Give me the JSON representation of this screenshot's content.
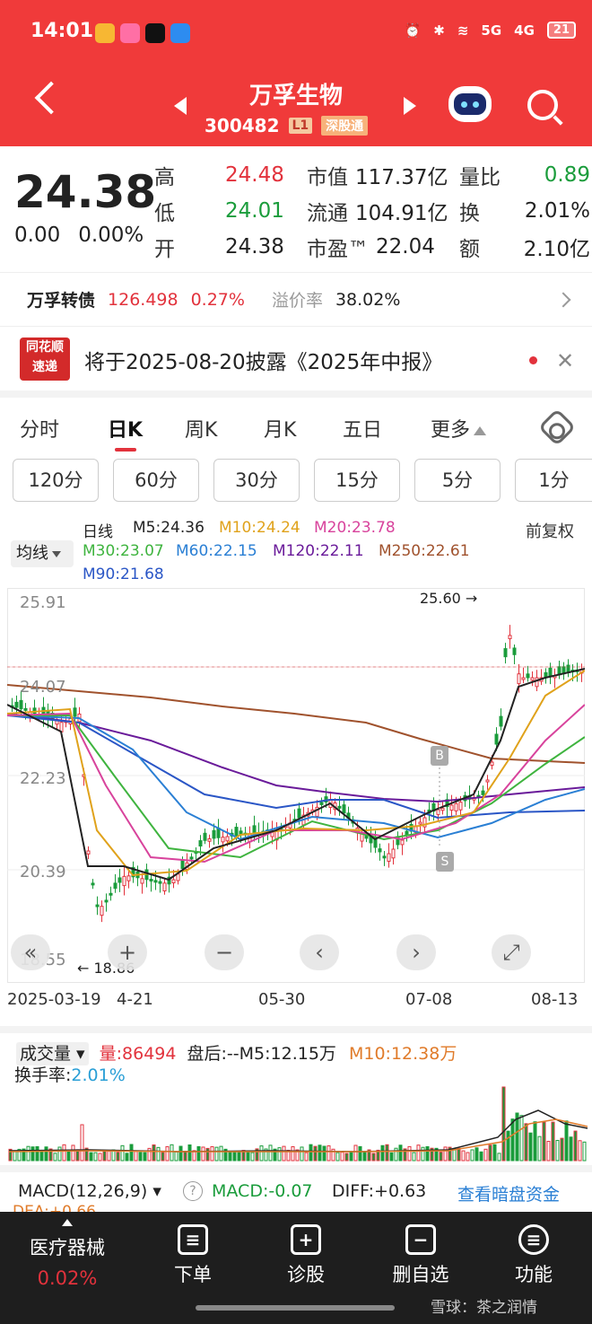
{
  "status_bar": {
    "time": "14:01",
    "net1": "5G",
    "net2": "4G",
    "battery": "21"
  },
  "header": {
    "name": "万孚生物",
    "code": "300482",
    "level_tag": "L1",
    "connect_tag": "深股通"
  },
  "quote": {
    "price": "24.38",
    "change": "0.00",
    "change_pct": "0.00%",
    "high_label": "高",
    "high": "24.48",
    "low_label": "低",
    "low": "24.01",
    "open_label": "开",
    "open": "24.38",
    "mktcap_label": "市值",
    "mktcap": "117.37亿",
    "float_label": "流通",
    "float": "104.91亿",
    "pe_label": "市盈™",
    "pe": "22.04",
    "volratio_label": "量比",
    "volratio": "0.89",
    "turnover_label": "换",
    "turnover": "2.01%",
    "amount_label": "额",
    "amount": "2.10亿"
  },
  "bond": {
    "name": "万孚转债",
    "price": "126.498",
    "pct": "0.27%",
    "premium_label": "溢价率",
    "premium": "38.02%"
  },
  "news": {
    "logo1": "同花顺",
    "logo2": "速递",
    "text": "将于2025-08-20披露《2025年中报》"
  },
  "tabs": [
    "分时",
    "日K",
    "周K",
    "月K",
    "五日",
    "更多"
  ],
  "periods": [
    "120分",
    "60分",
    "30分",
    "15分",
    "5分",
    "1分"
  ],
  "ma": {
    "selector": "均线",
    "line_type": "日线",
    "adjust": "前复权",
    "m5": "M5:24.36",
    "m10": "M10:24.24",
    "m20": "M20:23.78",
    "m30": "M30:23.07",
    "m60": "M60:22.15",
    "m120": "M120:22.11",
    "m250": "M250:22.61",
    "m90": "M90:21.68"
  },
  "chart": {
    "y_labels": [
      "25.91",
      "24.07",
      "22.23",
      "20.39",
      "18.55"
    ],
    "high_marker": "25.60",
    "low_marker": "18.86",
    "buy_tag": "B",
    "sell_tag": "S",
    "dates": [
      "2025-03-19",
      "4-21",
      "05-30",
      "07-08",
      "08-13"
    ],
    "controls": [
      "«",
      "+",
      "−",
      "‹",
      "›",
      "⤢"
    ]
  },
  "volume": {
    "selector": "成交量",
    "vol": "量:86494",
    "after": "盘后:--",
    "m5": "M5:12.15万",
    "m10": "M10:12.38万",
    "turnover_label": "换手率:",
    "turnover": "2.01%"
  },
  "macd": {
    "selector": "MACD(12,26,9)",
    "help": "?",
    "macd": "MACD:-0.07",
    "diff": "DIFF:+0.63",
    "link": "查看暗盘资金",
    "dea": "DEA:+0.66"
  },
  "nav": {
    "sector": "医疗器械",
    "sector_pct": "0.02%",
    "items": [
      "下单",
      "诊股",
      "删自选",
      "功能"
    ],
    "watermark": "雪球：茶之润情"
  },
  "colors": {
    "up": "#e2323c",
    "down": "#1a9c3b",
    "brand": "#f03a3a"
  },
  "chart_data": {
    "type": "candlestick",
    "y_axis_labels": [
      25.91,
      24.07,
      22.23,
      20.39,
      18.55
    ],
    "ylim": [
      18.55,
      25.91
    ],
    "x_axis_labels": [
      "2025-03-19",
      "4-21",
      "05-30",
      "07-08",
      "08-13"
    ],
    "annotations": [
      {
        "label": "25.60",
        "kind": "high"
      },
      {
        "label": "18.86",
        "kind": "low"
      }
    ]
  }
}
